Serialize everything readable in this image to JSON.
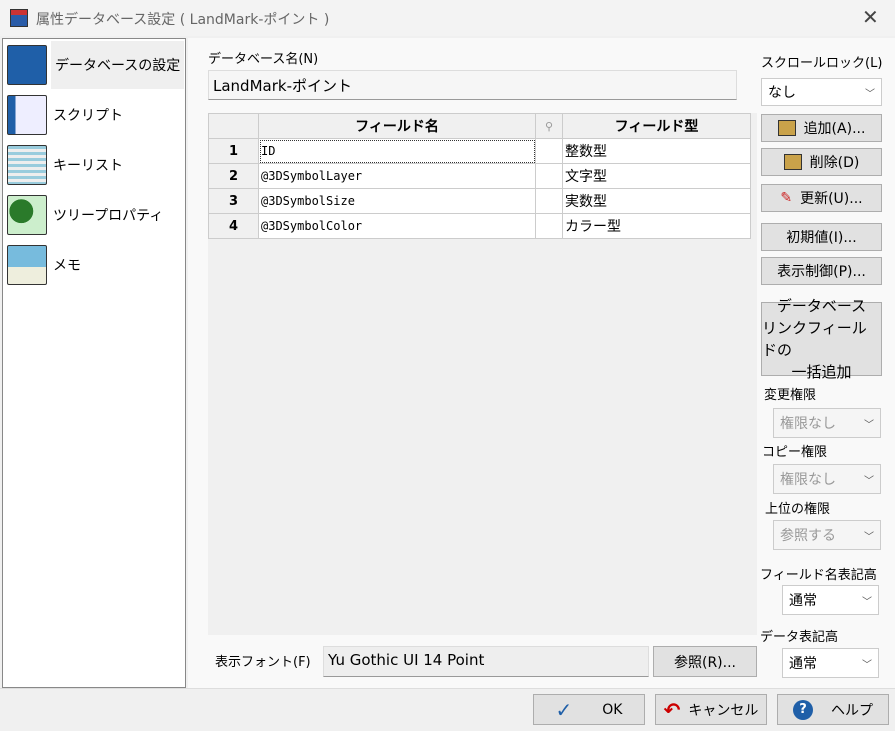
{
  "window": {
    "title": "属性データベース設定 ( LandMark-ポイント )"
  },
  "sidebar": {
    "items": [
      {
        "label": "データベースの設定",
        "icon": "database-settings-icon",
        "selected": true
      },
      {
        "label": "スクリプト",
        "icon": "script-icon"
      },
      {
        "label": "キーリスト",
        "icon": "keylist-icon"
      },
      {
        "label": "ツリープロパティ",
        "icon": "tree-property-icon"
      },
      {
        "label": "メモ",
        "icon": "memo-icon"
      }
    ]
  },
  "db": {
    "label": "データベース名(N)",
    "value": "LandMark-ポイント"
  },
  "grid": {
    "headers": [
      "フィールド名",
      "フィールド型"
    ],
    "rows": [
      {
        "n": "1",
        "name": "ID",
        "type": "整数型"
      },
      {
        "n": "2",
        "name": "@3DSymbolLayer",
        "type": "文字型"
      },
      {
        "n": "3",
        "name": "@3DSymbolSize",
        "type": "実数型"
      },
      {
        "n": "4",
        "name": "@3DSymbolColor",
        "type": "カラー型"
      }
    ]
  },
  "font": {
    "label": "表示フォント(F)",
    "value": "Yu Gothic UI 14 Point",
    "browse": "参照(R)..."
  },
  "right": {
    "scroll_lock_label": "スクロールロック(L)",
    "scroll_lock": "なし",
    "add": "追加(A)...",
    "delete": "削除(D)",
    "update": "更新(U)...",
    "initial": "初期値(I)...",
    "display": "表示制御(P)...",
    "bulk": [
      "データベース",
      "リンクフィールドの",
      "一括追加"
    ],
    "change_perm_label": "変更権限",
    "change_perm": "権限なし",
    "copy_perm_label": "コピー権限",
    "copy_perm": "権限なし",
    "upper_perm_label": "上位の権限",
    "upper_perm": "参照する",
    "field_height_label": "フィールド名表記高",
    "field_height": "通常",
    "data_height_label": "データ表記高",
    "data_height": "通常"
  },
  "footer": {
    "ok": "OK",
    "cancel": "キャンセル",
    "help": "ヘルプ"
  }
}
